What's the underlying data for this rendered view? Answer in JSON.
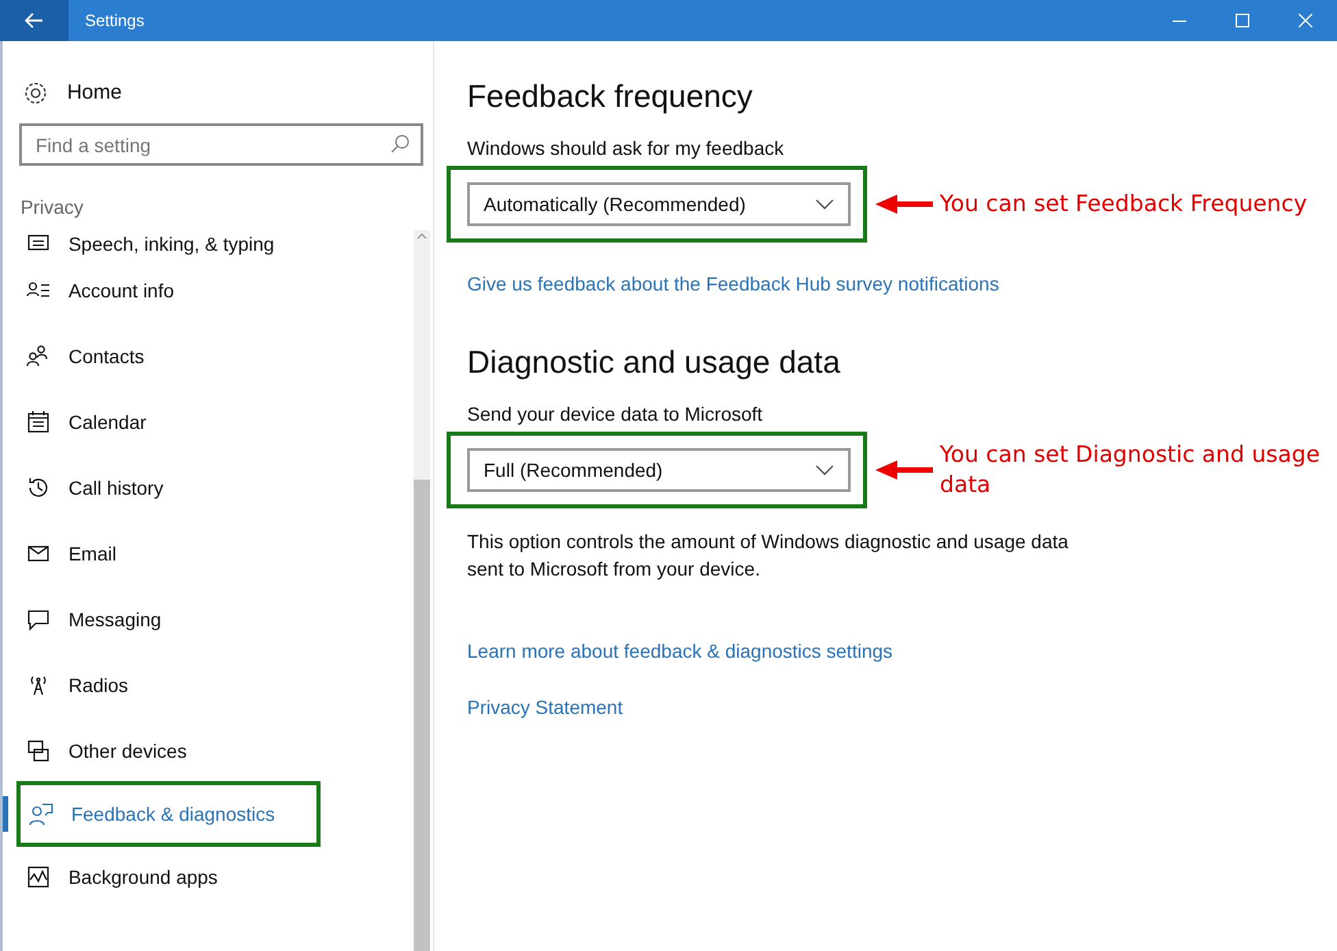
{
  "window": {
    "title": "Settings"
  },
  "sidebar": {
    "home": "Home",
    "search": {
      "placeholder": "Find a setting"
    },
    "section": "Privacy",
    "items": [
      {
        "label": "Speech, inking, & typing",
        "selected": false,
        "highlighted": false
      },
      {
        "label": "Account info",
        "selected": false,
        "highlighted": false
      },
      {
        "label": "Contacts",
        "selected": false,
        "highlighted": false
      },
      {
        "label": "Calendar",
        "selected": false,
        "highlighted": false
      },
      {
        "label": "Call history",
        "selected": false,
        "highlighted": false
      },
      {
        "label": "Email",
        "selected": false,
        "highlighted": false
      },
      {
        "label": "Messaging",
        "selected": false,
        "highlighted": false
      },
      {
        "label": "Radios",
        "selected": false,
        "highlighted": false
      },
      {
        "label": "Other devices",
        "selected": false,
        "highlighted": false
      },
      {
        "label": "Feedback & diagnostics",
        "selected": true,
        "highlighted": true
      },
      {
        "label": "Background apps",
        "selected": false,
        "highlighted": false
      }
    ]
  },
  "content": {
    "sections": [
      {
        "heading": "Feedback frequency",
        "label": "Windows should ask for my feedback",
        "dropdown": {
          "value": "Automatically (Recommended)",
          "highlighted": true
        },
        "annotation": "You can set Feedback Frequency",
        "links": [
          "Give us feedback about the Feedback Hub survey notifications"
        ]
      },
      {
        "heading": "Diagnostic and usage data",
        "label": "Send your device data to Microsoft",
        "dropdown": {
          "value": "Full (Recommended)",
          "highlighted": true
        },
        "annotation": "You can set Diagnostic and usage data",
        "description": "This option controls the amount of Windows diagnostic and usage data sent to Microsoft from your device.",
        "links": [
          "Learn more about feedback & diagnostics settings",
          "Privacy Statement"
        ]
      }
    ]
  }
}
